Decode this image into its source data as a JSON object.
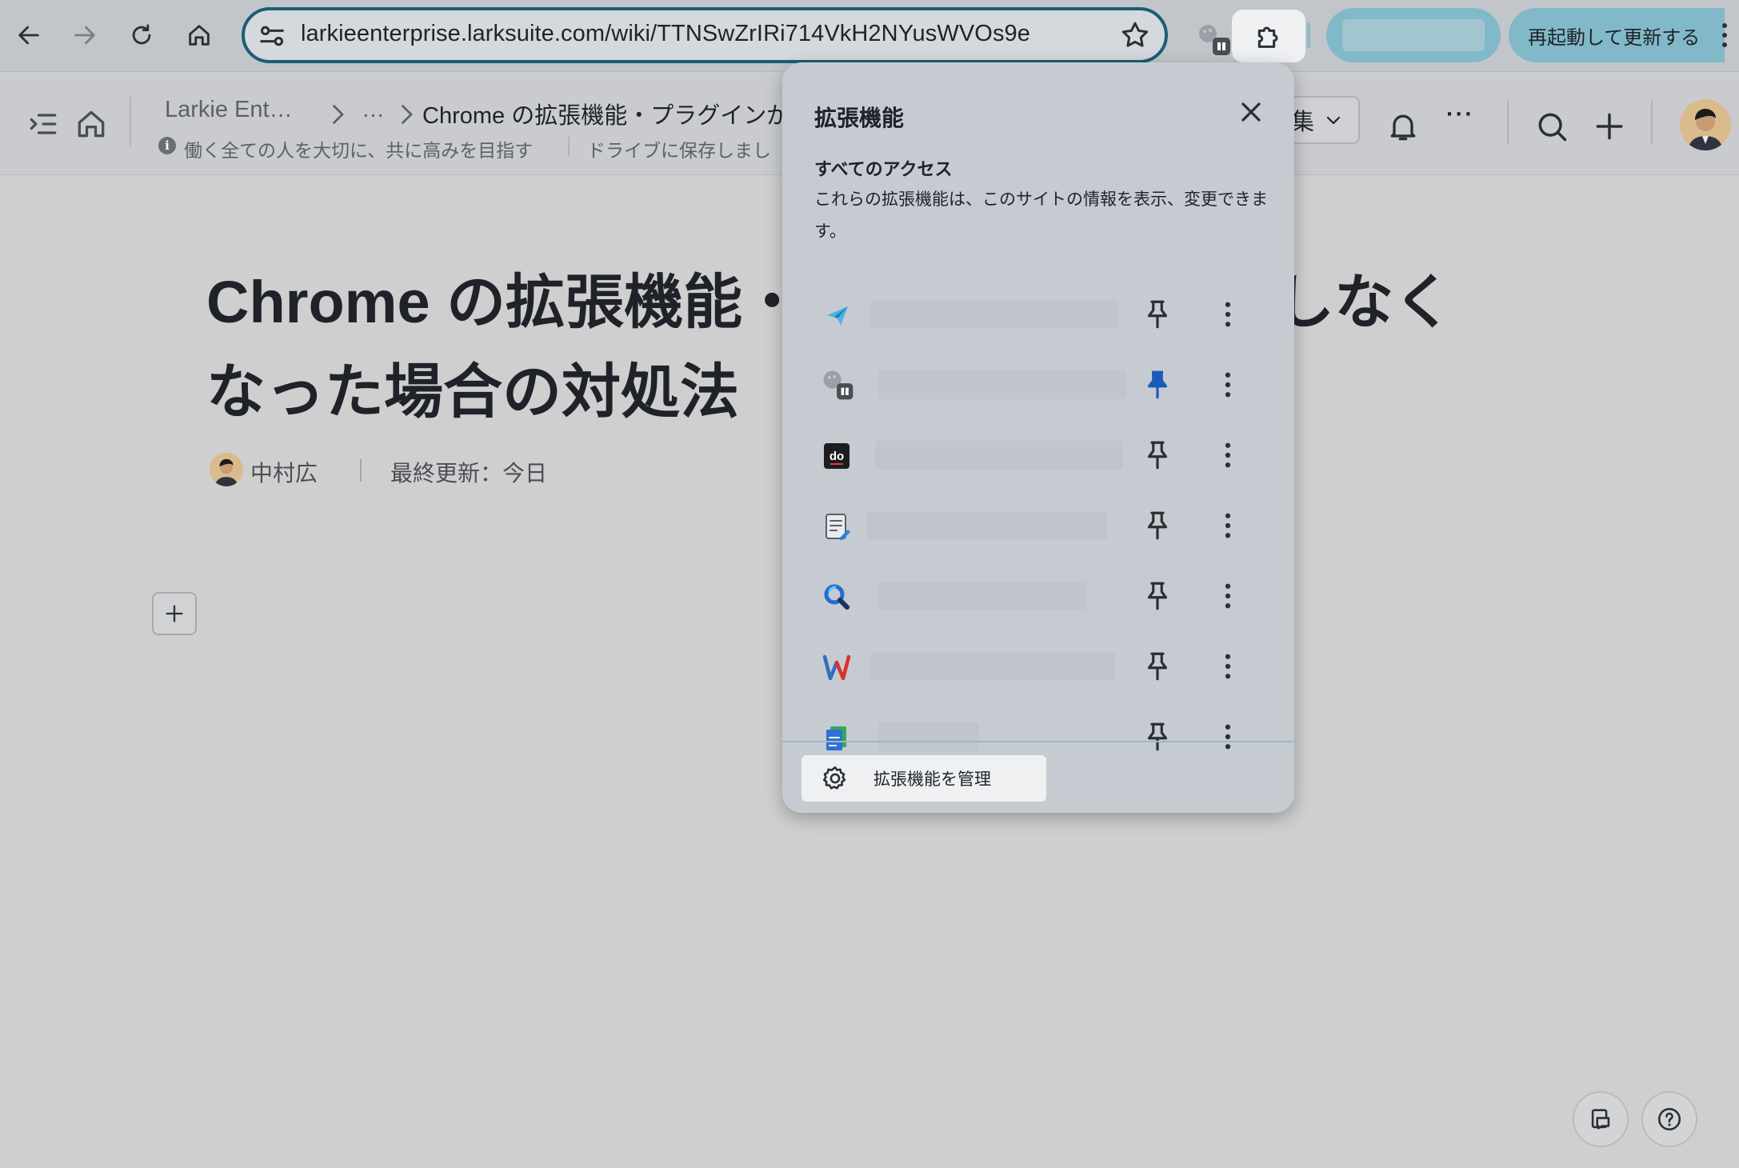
{
  "browser": {
    "url": "larkieenterprise.larksuite.com/wiki/TTNSwZrIRi714VkH2NYusWVOs9e",
    "update_label": "再起動して更新する"
  },
  "doc_header": {
    "breadcrumb_root": "Larkie Ent…",
    "breadcrumb_ellipsis": "…",
    "breadcrumb_current": "Chrome の拡張機能・プラグインが",
    "tagline": "働く全ての人を大切に、共に高みを目指す",
    "drive_notice": "ドライブに保存しまし",
    "edit_label": "集",
    "more_label": "···"
  },
  "document": {
    "title": "Chrome の拡張機能・プラグインが動作しなくなった場合の対処法",
    "author": "中村広",
    "last_updated": "最終更新：今日"
  },
  "extensions_popup": {
    "title": "拡張機能",
    "section_heading": "すべてのアクセス",
    "section_description": "これらの拡張機能は、このサイトの情報を表示、変更できます。",
    "manage_label": "拡張機能を管理",
    "items": [
      {
        "icon": "paper-plane-icon",
        "pinned": false
      },
      {
        "icon": "paused-extension-icon",
        "pinned": true
      },
      {
        "icon": "do-logo-icon",
        "pinned": false
      },
      {
        "icon": "notepad-icon",
        "pinned": false
      },
      {
        "icon": "magnifier-icon",
        "pinned": false
      },
      {
        "icon": "w-logo-icon",
        "pinned": false
      },
      {
        "icon": "docs-icon",
        "pinned": false
      }
    ]
  },
  "colors": {
    "omnibox_border": "#1b5f73",
    "profile_pill": "#82b9c9",
    "pin_active": "#1a5bb8",
    "popup_background": "#c5cbd1"
  }
}
